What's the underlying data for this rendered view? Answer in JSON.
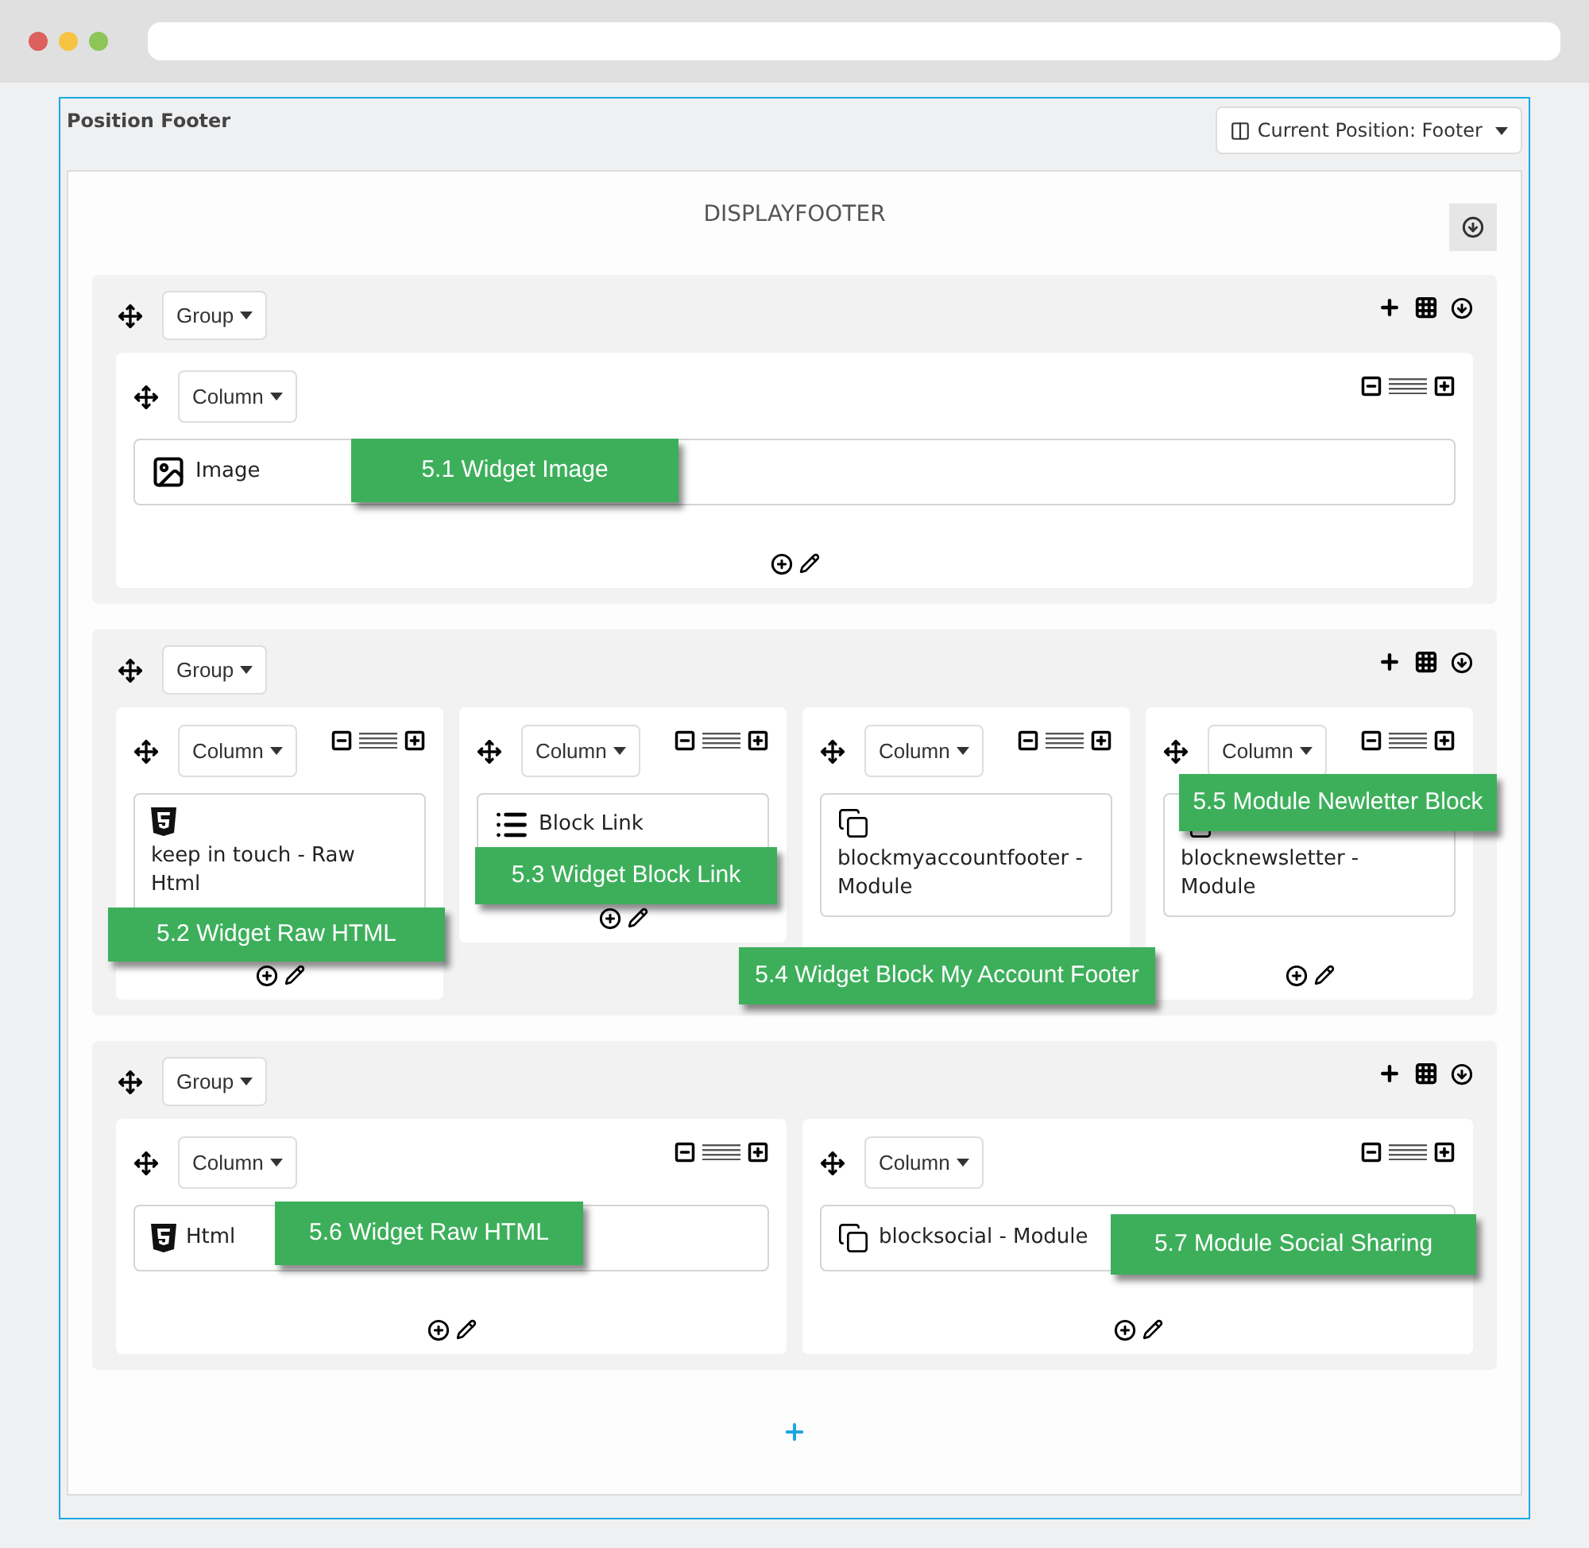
{
  "panel": {
    "title": "Position Footer",
    "position_button": "Current Position: Footer",
    "hook": "DISPLAYFOOTER"
  },
  "groups": [
    {
      "label": "Group",
      "columns": [
        {
          "label": "Column",
          "widgets": [
            {
              "kind": "image",
              "text": "Image",
              "callout": "5.1 Widget Image"
            }
          ]
        }
      ]
    },
    {
      "label": "Group",
      "columns": [
        {
          "label": "Column",
          "widgets": [
            {
              "kind": "html",
              "text": "keep in touch - Raw Html",
              "callout": "5.2 Widget Raw HTML"
            }
          ]
        },
        {
          "label": "Column",
          "widgets": [
            {
              "kind": "list",
              "text": "Block Link",
              "callout": "5.3 Widget Block Link"
            }
          ]
        },
        {
          "label": "Column",
          "widgets": [
            {
              "kind": "module",
              "text": "blockmyaccountfooter - Module",
              "callout": "5.4 Widget Block My Account Footer"
            }
          ]
        },
        {
          "label": "Column",
          "widgets": [
            {
              "kind": "module",
              "text": "blocknewsletter - Module",
              "callout": "5.5 Module Newletter Block"
            }
          ]
        }
      ]
    },
    {
      "label": "Group",
      "columns": [
        {
          "label": "Column",
          "widgets": [
            {
              "kind": "html",
              "text": "Html",
              "callout": "5.6 Widget Raw HTML"
            }
          ]
        },
        {
          "label": "Column",
          "widgets": [
            {
              "kind": "module",
              "text": "blocksocial - Module",
              "callout": "5.7 Module Social Sharing"
            }
          ]
        }
      ]
    }
  ]
}
